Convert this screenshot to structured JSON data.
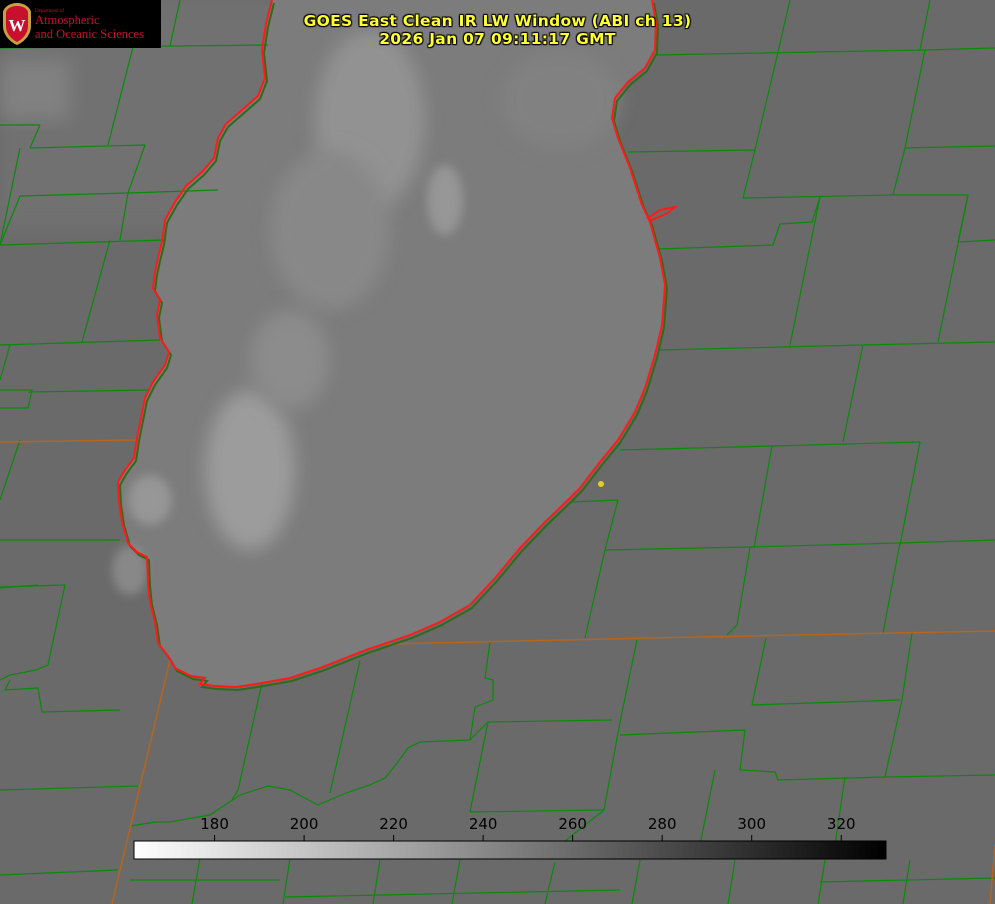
{
  "title": {
    "line1": "GOES East Clean IR LW Window (ABI ch 13)",
    "line2": "2026 Jan 07 09:11:17 GMT"
  },
  "logo": {
    "department": "Department of",
    "line1": "Atmospheric",
    "line2": "and Oceanic Sciences",
    "seal_letter": "W"
  },
  "colorbar": {
    "ticks": [
      "180",
      "200",
      "220",
      "240",
      "260",
      "280",
      "300",
      "320"
    ],
    "min": 162,
    "max": 330,
    "ramp": "white-to-black"
  },
  "colors": {
    "county_lines": "#0a8a0a",
    "state_lines": "#b5651d",
    "shoreline": "#ff1a1a",
    "title_text": "#ffff33",
    "marker": "#e0d020"
  },
  "markers": [
    {
      "name": "station-dot",
      "color": "#e0d020"
    }
  ]
}
